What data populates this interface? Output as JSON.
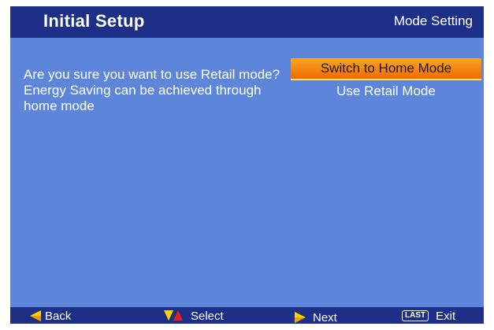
{
  "header": {
    "title": "Initial  Setup",
    "subtitle": "Mode Setting"
  },
  "message": "Are you sure you want to use Retail mode? Energy Saving can be achieved through home mode",
  "options": [
    {
      "label": "Switch to Home Mode",
      "selected": true
    },
    {
      "label": "Use Retail Mode",
      "selected": false
    }
  ],
  "footer": {
    "back": {
      "label": "Back",
      "icon": "left-arrow-icon"
    },
    "select": {
      "label": "Select",
      "icon": "up-down-arrows-icon"
    },
    "next": {
      "label": "Next",
      "icon": "right-arrow-icon"
    },
    "exit": {
      "label": "Exit",
      "key": "LAST"
    }
  },
  "colors": {
    "background": "#5d86db",
    "bar": "#1d2f86",
    "highlight": "#f5891a",
    "arrow_yellow": "#ffd400",
    "arrow_red": "#e8201c"
  }
}
